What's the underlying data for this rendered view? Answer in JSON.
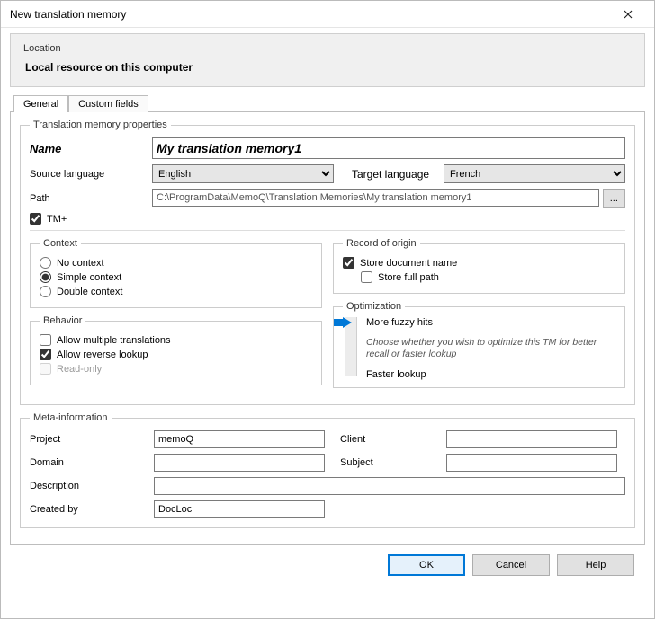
{
  "window": {
    "title": "New translation memory"
  },
  "location": {
    "label": "Location",
    "value": "Local resource on this computer"
  },
  "tabs": {
    "general": "General",
    "custom_fields": "Custom fields"
  },
  "props": {
    "legend": "Translation memory properties",
    "name_label": "Name",
    "name_value": "My translation memory1",
    "source_lang_label": "Source language",
    "source_lang_value": "English",
    "target_lang_label": "Target language",
    "target_lang_value": "French",
    "path_label": "Path",
    "path_value": "C:\\ProgramData\\MemoQ\\Translation Memories\\My translation memory1",
    "browse": "...",
    "tm_plus_label": "TM+"
  },
  "context": {
    "legend": "Context",
    "no_context": "No context",
    "simple_context": "Simple context",
    "double_context": "Double context"
  },
  "behavior": {
    "legend": "Behavior",
    "allow_multiple": "Allow multiple translations",
    "allow_reverse": "Allow reverse lookup",
    "read_only": "Read-only"
  },
  "record": {
    "legend": "Record of origin",
    "store_doc": "Store document name",
    "store_full_path": "Store full path"
  },
  "optimization": {
    "legend": "Optimization",
    "more_fuzzy": "More fuzzy hits",
    "faster_lookup": "Faster lookup",
    "hint": "Choose whether you wish to optimize this TM for better recall or faster lookup"
  },
  "meta": {
    "legend": "Meta-information",
    "project_label": "Project",
    "project_value": "memoQ",
    "client_label": "Client",
    "client_value": "",
    "domain_label": "Domain",
    "domain_value": "",
    "subject_label": "Subject",
    "subject_value": "",
    "description_label": "Description",
    "description_value": "",
    "created_by_label": "Created by",
    "created_by_value": "DocLoc"
  },
  "buttons": {
    "ok": "OK",
    "cancel": "Cancel",
    "help": "Help"
  }
}
